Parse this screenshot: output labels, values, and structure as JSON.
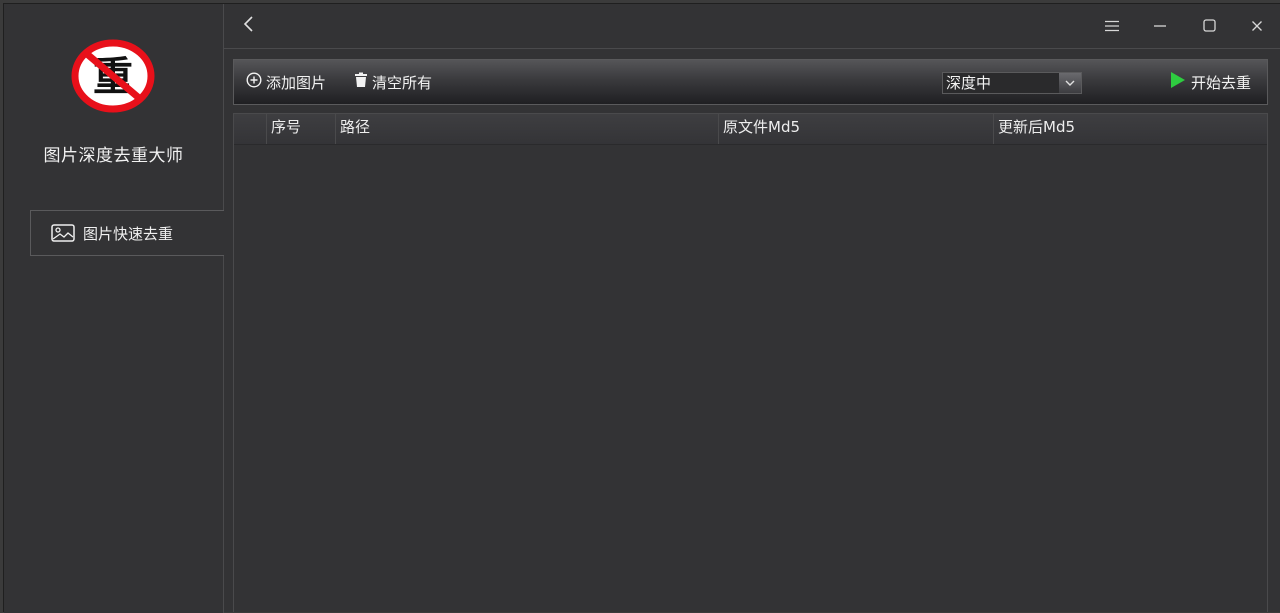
{
  "app": {
    "title": "图片深度去重大师",
    "logo_char": "重"
  },
  "sidebar": {
    "items": [
      {
        "label": "图片快速去重",
        "icon": "image-icon",
        "selected": true
      }
    ]
  },
  "titlebar": {
    "back_icon": "chevron-left-icon",
    "menu_icon": "hamburger-menu-icon",
    "minimize_icon": "minimize-icon",
    "maximize_icon": "maximize-icon",
    "close_icon": "close-icon"
  },
  "toolbar": {
    "add_label": "添加图片",
    "clear_label": "清空所有",
    "mode_selected": "深度中",
    "start_label": "开始去重"
  },
  "table": {
    "columns": [
      "序号",
      "路径",
      "原文件Md5",
      "更新后Md5"
    ],
    "rows": []
  },
  "colors": {
    "background": "#333335",
    "accent_green": "#2ecc40",
    "logo_red": "#e8101a"
  }
}
